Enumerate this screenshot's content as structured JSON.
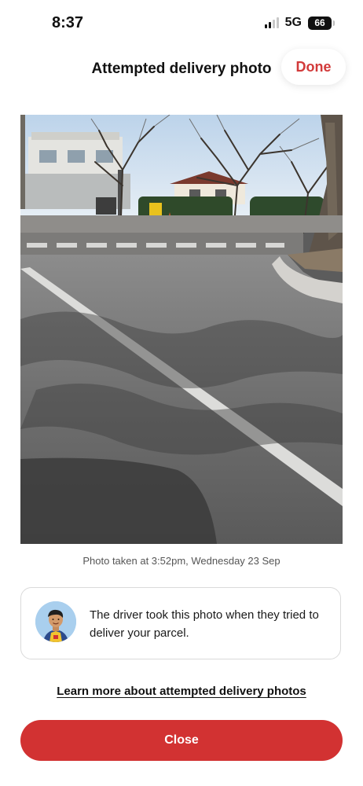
{
  "status_bar": {
    "time": "8:37",
    "network": "5G",
    "battery": "66"
  },
  "header": {
    "title": "Attempted delivery photo",
    "done_label": "Done"
  },
  "photo": {
    "caption": "Photo taken at 3:52pm, Wednesday 23 Sep"
  },
  "info_card": {
    "text": "The driver took this photo when they tried to deliver your parcel."
  },
  "learn_more_link": "Learn more about attempted delivery photos",
  "close_button_label": "Close",
  "colors": {
    "accent": "#d23232",
    "card_border": "#dadada",
    "caption_text": "#555555"
  },
  "icons": [
    "signal-icon",
    "battery-icon",
    "driver-avatar-icon"
  ]
}
